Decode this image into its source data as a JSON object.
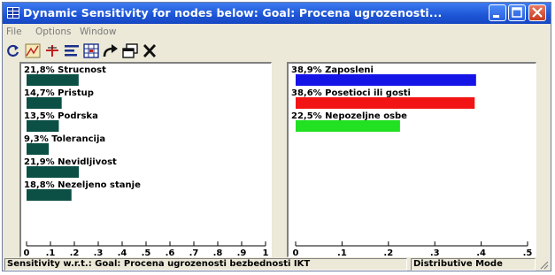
{
  "window": {
    "title": "Dynamic Sensitivity for nodes below: Goal: Procena ugrozenosti...",
    "controls": [
      "minimize",
      "maximize",
      "close"
    ]
  },
  "menu": {
    "items": [
      "File",
      "Options",
      "Window"
    ]
  },
  "toolbar": {
    "icons": [
      "refresh-icon",
      "sensitivity-curve-icon",
      "cross-hair-icon",
      "sort-icon",
      "grid-icon",
      "redo-arrow-icon",
      "copy-window-icon",
      "close-x-icon"
    ]
  },
  "chart_data": [
    {
      "type": "bar",
      "orientation": "horizontal",
      "categories": [
        "Strucnost",
        "Pristup",
        "Podrska",
        "Tolerancija",
        "Nevidljivost",
        "Nezeljeno stanje"
      ],
      "labels": [
        "21,8% Strucnost",
        "14,7% Pristup",
        "13,5% Podrska",
        "9,3% Tolerancija",
        "21,9% Nevidljivost",
        "18,8% Nezeljeno stanje"
      ],
      "values": [
        0.218,
        0.147,
        0.135,
        0.093,
        0.219,
        0.188
      ],
      "colors": [
        "#0b4f45"
      ],
      "xlim": [
        0,
        1
      ],
      "ticks": [
        "0",
        ".1",
        ".2",
        ".3",
        ".4",
        ".5",
        ".6",
        ".7",
        ".8",
        ".9",
        "1"
      ]
    },
    {
      "type": "bar",
      "orientation": "horizontal",
      "categories": [
        "Zaposleni",
        "Posetioci ili gosti",
        "Nepozeljne osbe"
      ],
      "labels": [
        "38,9% Zaposleni",
        "38,6% Posetioci ili gosti",
        "22,5% Nepozeljne osbe"
      ],
      "values": [
        0.389,
        0.386,
        0.225
      ],
      "colors": [
        "#1414e6",
        "#f21414",
        "#22e022"
      ],
      "xlim": [
        0,
        0.5
      ],
      "ticks": [
        "0",
        ".1",
        ".2",
        ".3",
        ".4",
        ".5"
      ]
    }
  ],
  "status": {
    "left": "Sensitivity w.r.t.: Goal: Procena ugrozenosti bezbednosti IKT",
    "right": "Distributive Mode"
  }
}
